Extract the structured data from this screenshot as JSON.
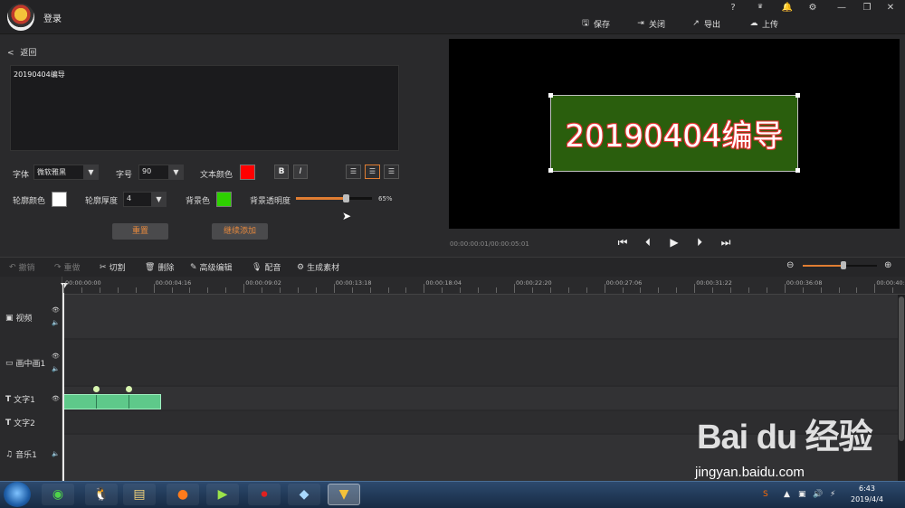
{
  "app": {
    "title": "登录"
  },
  "window_controls": [
    "?",
    "VIP",
    "🔔",
    "⚙",
    "—",
    "❐",
    "✕"
  ],
  "header_actions": [
    {
      "label": "保存",
      "icon": "save-icon"
    },
    {
      "label": "关闭",
      "icon": "close-doc-icon"
    },
    {
      "label": "导出",
      "icon": "export-icon"
    },
    {
      "label": "上传",
      "icon": "upload-icon"
    }
  ],
  "editor": {
    "back_label": "返回",
    "text_value": "20190404编导",
    "font_label": "字体",
    "font_value": "微软雅黑",
    "size_label": "字号",
    "size_value": "90",
    "text_color_label": "文本颜色",
    "text_color": "#ff0000",
    "bold_label": "B",
    "italic_label": "I",
    "outline_color_label": "轮廓颜色",
    "outline_color": "#ffffff",
    "outline_width_label": "轮廓厚度",
    "outline_width_value": "4",
    "bg_color_label": "背景色",
    "bg_color": "#2ed100",
    "bg_opacity_label": "背景透明度",
    "bg_opacity_value": "65%",
    "bg_opacity": 0.65,
    "reset_label": "重置",
    "continue_add_label": "继续添加"
  },
  "preview": {
    "caption_text": "20190404编导",
    "timecode": "00:00:00:01/00:00:05:01"
  },
  "toolbar": {
    "undo": "撤销",
    "redo": "重做",
    "cut": "切割",
    "delete": "删除",
    "advanced_edit": "高级编辑",
    "dub": "配音",
    "generate_material": "生成素材",
    "zoom_level": 0.55
  },
  "timeline": {
    "ruler_labels": [
      "00:00:00:00",
      "00:00:04:16",
      "00:00:09:02",
      "00:00:13:18",
      "00:00:18:04",
      "00:00:22:20",
      "00:00:27:06",
      "00:00:31:22",
      "00:00:36:08",
      "00:00:40:"
    ],
    "tracks": [
      {
        "name": "视频",
        "icon": "video-track-icon"
      },
      {
        "name": "画中画1",
        "icon": "pip-track-icon"
      },
      {
        "name": "文字1",
        "icon": "text-track-icon"
      },
      {
        "name": "文字2",
        "icon": "text-track-icon"
      },
      {
        "name": "音乐1",
        "icon": "music-track-icon"
      }
    ]
  },
  "taskbar": {
    "time": "6:43",
    "date": "2019/4/4"
  },
  "watermark": {
    "brand": "Bai du 经验",
    "url": "jingyan.baidu.com"
  }
}
